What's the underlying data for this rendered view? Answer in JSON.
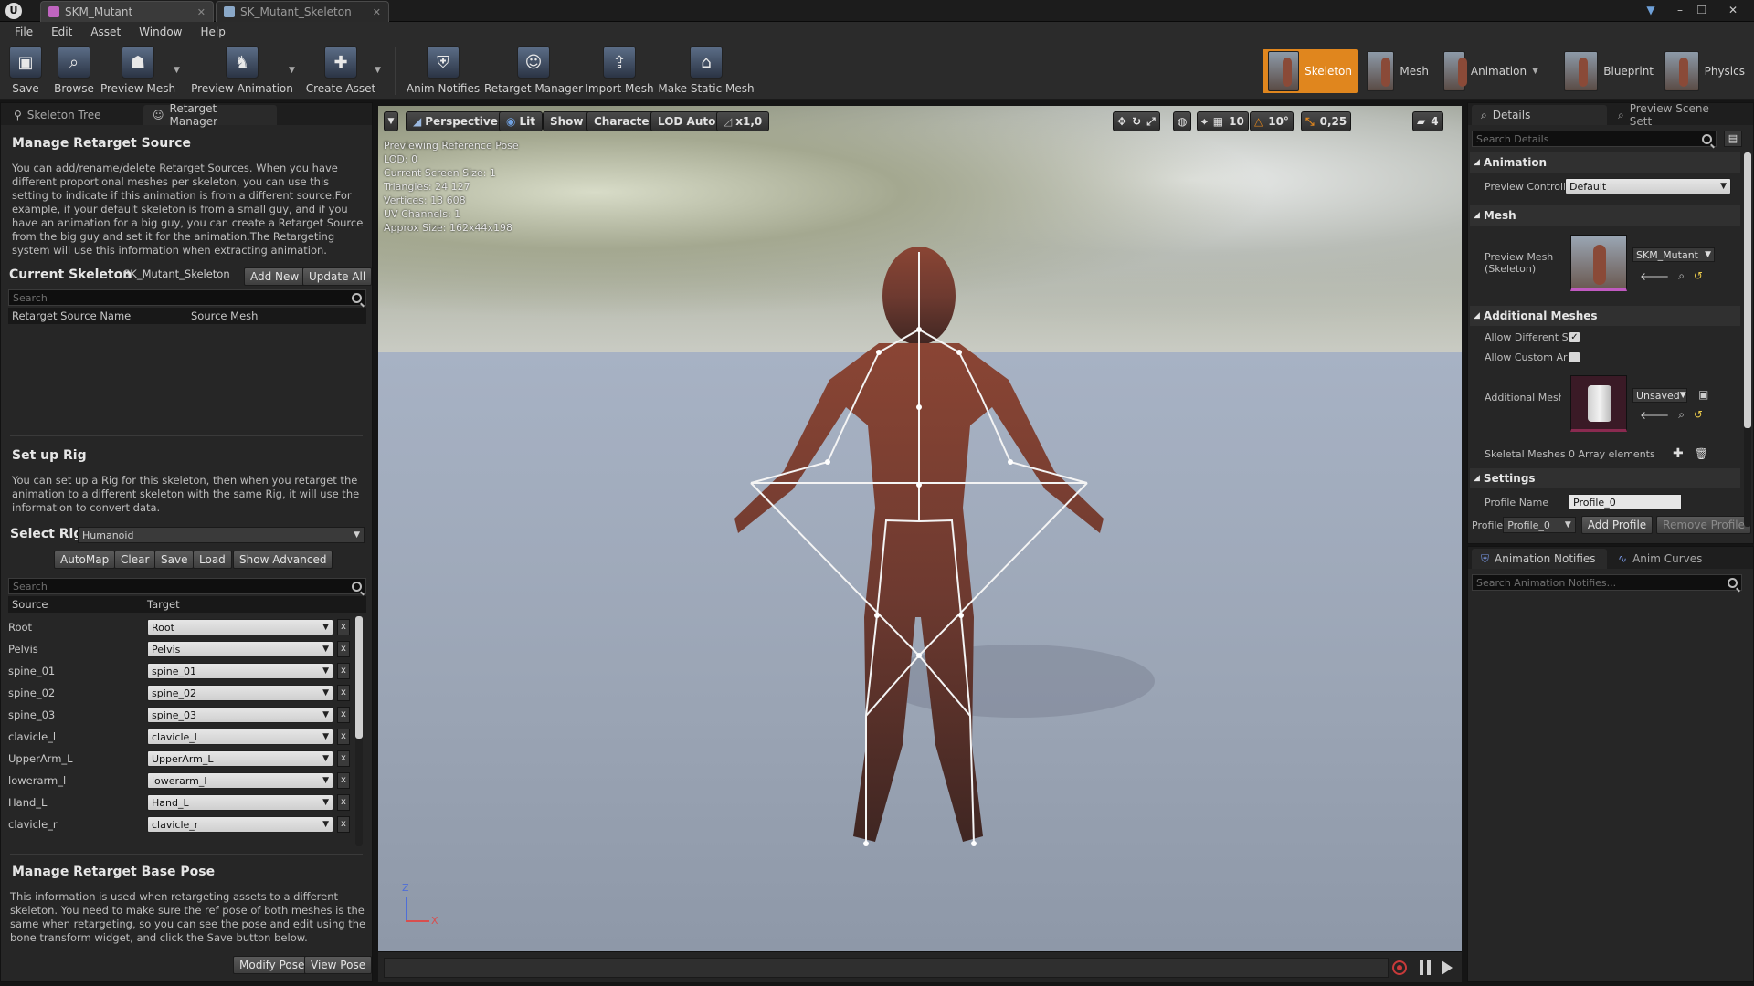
{
  "titlebar": {
    "tabs": [
      {
        "label": "SKM_Mutant",
        "color": "#c065c0"
      },
      {
        "label": "SK_Mutant_Skeleton",
        "color": "#8aa8c8"
      }
    ]
  },
  "menu": [
    "File",
    "Edit",
    "Asset",
    "Window",
    "Help"
  ],
  "toolbar": {
    "buttons": [
      "Save",
      "Browse",
      "Preview Mesh",
      "Preview Animation",
      "Create Asset",
      "Anim Notifies",
      "Retarget Manager",
      "Import Mesh",
      "Make Static Mesh"
    ],
    "modes": [
      "Skeleton",
      "Mesh",
      "Animation",
      "Blueprint",
      "Physics"
    ]
  },
  "left": {
    "tabs": [
      "Skeleton Tree",
      "Retarget Manager"
    ],
    "manage_source": {
      "title": "Manage Retarget Source",
      "desc": "You can add/rename/delete Retarget Sources. When you have different proportional meshes per skeleton, you can use this setting to indicate if this animation is from a different source.For example, if your default skeleton is from a small guy, and if you have an animation for a big guy, you can create a Retarget Source from the big guy and set it for the animation.The Retargeting system will use this information when extracting animation.",
      "current_skeleton_label": "Current Skeleton",
      "current_skeleton_value": "SK_Mutant_Skeleton",
      "add_new": "Add New",
      "update_all": "Update All",
      "search_placeholder": "Search",
      "col_name": "Retarget Source Name",
      "col_mesh": "Source Mesh"
    },
    "rig": {
      "title": "Set up Rig",
      "desc": "You can set up a Rig for this skeleton, then when you retarget the animation to a different skeleton with the same Rig, it will use the information to convert data.",
      "select_label": "Select Rig",
      "select_value": "Humanoid",
      "buttons": [
        "AutoMap",
        "Clear",
        "Save",
        "Load",
        "Show Advanced"
      ],
      "search_placeholder": "Search",
      "col_source": "Source",
      "col_target": "Target",
      "x": "x",
      "rows": [
        {
          "source": "Root",
          "target": "Root"
        },
        {
          "source": "Pelvis",
          "target": "Pelvis"
        },
        {
          "source": "spine_01",
          "target": "spine_01"
        },
        {
          "source": "spine_02",
          "target": "spine_02"
        },
        {
          "source": "spine_03",
          "target": "spine_03"
        },
        {
          "source": "clavicle_l",
          "target": "clavicle_l"
        },
        {
          "source": "UpperArm_L",
          "target": "UpperArm_L"
        },
        {
          "source": "lowerarm_l",
          "target": "lowerarm_l"
        },
        {
          "source": "Hand_L",
          "target": "Hand_L"
        },
        {
          "source": "clavicle_r",
          "target": "clavicle_r"
        }
      ]
    },
    "base_pose": {
      "title": "Manage Retarget Base Pose",
      "desc": "This information is used when retargeting assets to a different skeleton. You need to make sure the ref pose of both meshes is the same when retargeting, so you can see the pose and edit using the bone transform widget, and click the Save button below.",
      "modify": "Modify Pose",
      "view": "View Pose"
    }
  },
  "viewport": {
    "buttons": [
      "Perspective",
      "Lit",
      "Show",
      "Character",
      "LOD Auto",
      "x1,0"
    ],
    "snap": {
      "grid": "10",
      "rot": "10°",
      "scale": "0,25",
      "cam": "4"
    },
    "stats": [
      "Previewing Reference Pose",
      "LOD: 0",
      "Current Screen Size: 1",
      "Triangles: 24 127",
      "Vertices: 13 608",
      "UV Channels: 1",
      "Approx Size: 162x44x198"
    ],
    "axis": {
      "z": "Z",
      "x": "X"
    }
  },
  "right": {
    "tabs": [
      "Details",
      "Preview Scene Sett"
    ],
    "search_placeholder": "Search Details",
    "animation": {
      "title": "Animation",
      "label": "Preview Controll",
      "value": "Default"
    },
    "mesh": {
      "title": "Mesh",
      "label": "Preview Mesh (Skeleton)",
      "value": "SKM_Mutant"
    },
    "additional": {
      "title": "Additional Meshes",
      "allow_diff": "Allow Different S",
      "allow_custom": "Allow Custom Ar",
      "add_label": "Additional Meshe",
      "add_value": "Unsaved",
      "skel_label": "Skeletal Meshes",
      "skel_value": "0 Array elements"
    },
    "settings": {
      "title": "Settings",
      "profile_name_label": "Profile Name",
      "profile_name_value": "Profile_0",
      "profile_label": "Profile",
      "profile_value": "Profile_0",
      "add_profile": "Add Profile",
      "remove_profile": "Remove Profile"
    },
    "bottom_tabs": [
      "Animation Notifies",
      "Anim Curves"
    ],
    "notify_search": "Search Animation Notifies..."
  },
  "colors": {
    "accent": "#e0861e",
    "bg": "#262626"
  }
}
